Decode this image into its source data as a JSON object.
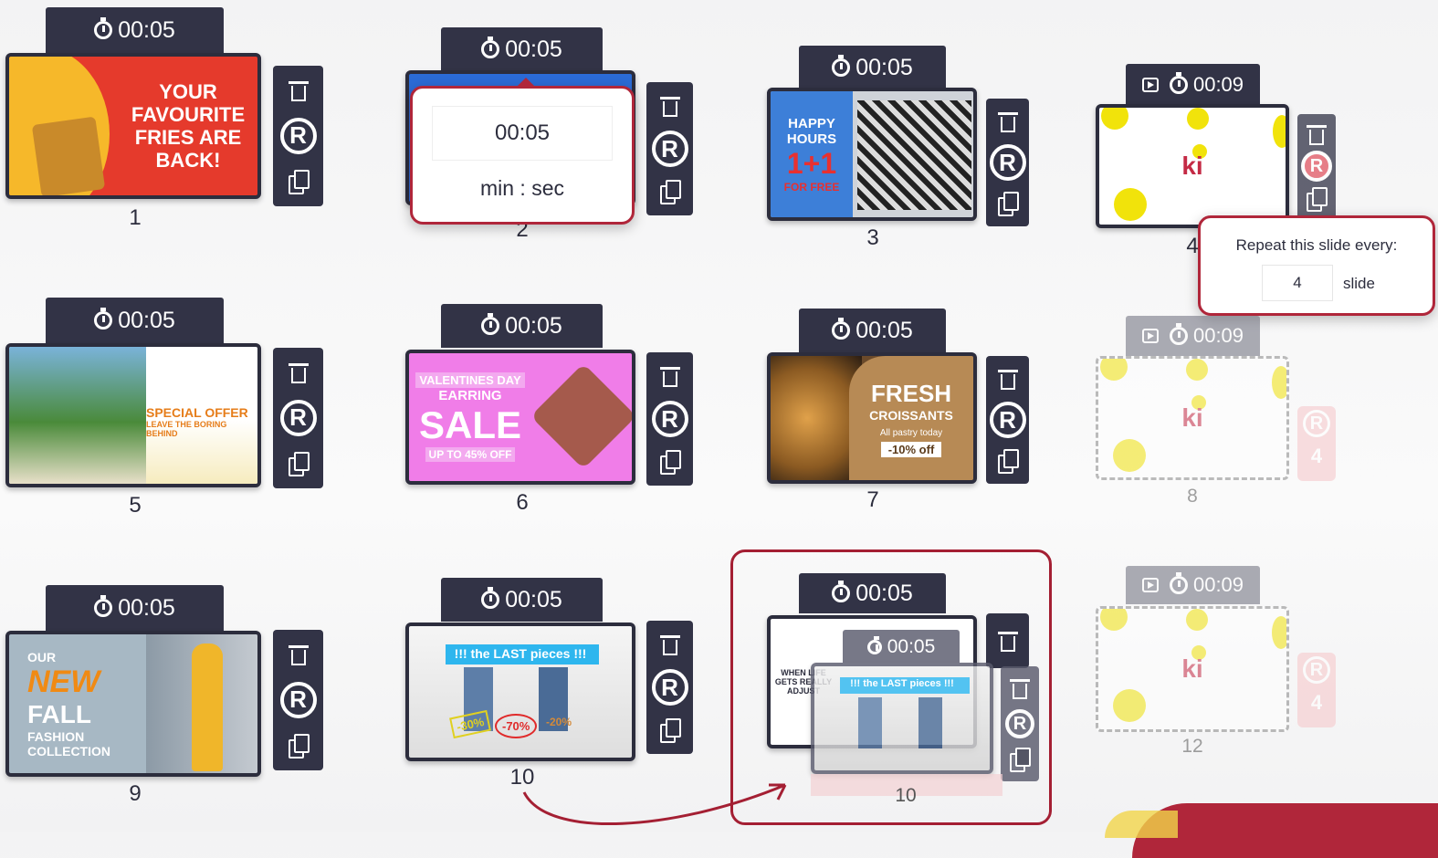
{
  "slides": [
    {
      "number": "1",
      "duration": "00:05",
      "art_lines": [
        "YOUR",
        "FAVOURITE",
        "FRIES ARE",
        "BACK!"
      ]
    },
    {
      "number": "2",
      "duration": "00:05"
    },
    {
      "number": "3",
      "duration": "00:05",
      "art_lines": [
        "HAPPY",
        "HOURS",
        "1+1",
        "FOR FREE"
      ]
    },
    {
      "number": "4",
      "duration": "00:09",
      "logo": "ki"
    },
    {
      "number": "5",
      "duration": "00:05",
      "art_lines": [
        "SPECIAL OFFER",
        "LEAVE THE BORING",
        "BEHIND"
      ]
    },
    {
      "number": "6",
      "duration": "00:05",
      "art_lines": [
        "VALENTINES DAY",
        "EARRING",
        "SALE",
        "UP TO 45% OFF"
      ]
    },
    {
      "number": "7",
      "duration": "00:05",
      "art_lines": [
        "FRESH",
        "CROISSANTS",
        "All pastry today",
        "-10% off"
      ]
    },
    {
      "number": "8",
      "duration": "00:09",
      "logo": "ki",
      "repeat_badge": "4"
    },
    {
      "number": "9",
      "duration": "00:05",
      "art_lines": [
        "OUR",
        "NEW",
        "FALL",
        "FASHION",
        "COLLECTION"
      ]
    },
    {
      "number": "10",
      "duration": "00:05",
      "art_lines": [
        "!!! the LAST pieces !!!",
        "-30%",
        "-70%",
        "-20%"
      ]
    },
    {
      "number": "10",
      "duration": "00:05",
      "art_lines": [
        "WHEN LIFE",
        "GETS REALLY",
        "ADJUST"
      ],
      "dragged_duration": "00:05",
      "dragged_banner": "!!! the LAST pieces !!!"
    },
    {
      "number": "12",
      "duration": "00:09",
      "logo": "ki",
      "repeat_badge": "4"
    }
  ],
  "duration_popup": {
    "value": "00:05",
    "unit_label": "min : sec"
  },
  "repeat_popup": {
    "label": "Repeat this slide every:",
    "value": "4",
    "unit": "slide"
  },
  "colors": {
    "dark": "#323346",
    "accent": "#b0263a",
    "yellow": "#f1e30b"
  }
}
